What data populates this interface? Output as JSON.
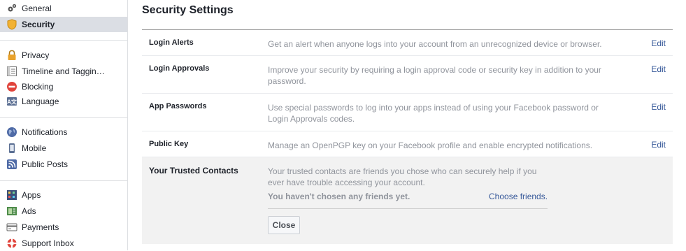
{
  "sidebar": {
    "items": [
      {
        "label": "General",
        "icon": "gears-icon"
      },
      {
        "label": "Security",
        "icon": "shield-icon"
      },
      {
        "label": "Privacy",
        "icon": "lock-icon"
      },
      {
        "label": "Timeline and Taggin…",
        "icon": "timeline-icon"
      },
      {
        "label": "Blocking",
        "icon": "blocking-icon"
      },
      {
        "label": "Language",
        "icon": "language-icon"
      },
      {
        "label": "Notifications",
        "icon": "globe-icon"
      },
      {
        "label": "Mobile",
        "icon": "mobile-icon"
      },
      {
        "label": "Public Posts",
        "icon": "rss-icon"
      },
      {
        "label": "Apps",
        "icon": "apps-icon"
      },
      {
        "label": "Ads",
        "icon": "ads-icon"
      },
      {
        "label": "Payments",
        "icon": "payments-icon"
      },
      {
        "label": "Support Inbox",
        "icon": "lifebuoy-icon"
      }
    ]
  },
  "main": {
    "title": "Security Settings",
    "rows": [
      {
        "name": "Login Alerts",
        "desc": "Get an alert when anyone logs into your account from an unrecognized device or browser.",
        "action": "Edit"
      },
      {
        "name": "Login Approvals",
        "desc": "Improve your security by requiring a login approval code or security key in addition to your password.",
        "action": "Edit"
      },
      {
        "name": "App Passwords",
        "desc": "Use special passwords to log into your apps instead of using your Facebook password or Login Approvals codes.",
        "action": "Edit"
      },
      {
        "name": "Public Key",
        "desc": "Manage an OpenPGP key on your Facebook profile and enable encrypted notifications.",
        "action": "Edit"
      }
    ],
    "trusted": {
      "name": "Your Trusted Contacts",
      "desc": "Your trusted contacts are friends you chose who can securely help if you ever have trouble accessing your account.",
      "status": "You haven't chosen any friends yet.",
      "choose": "Choose friends.",
      "close": "Close"
    }
  },
  "colors": {
    "link": "#365899",
    "muted": "#90949c",
    "active_bg": "#dbdee4"
  }
}
